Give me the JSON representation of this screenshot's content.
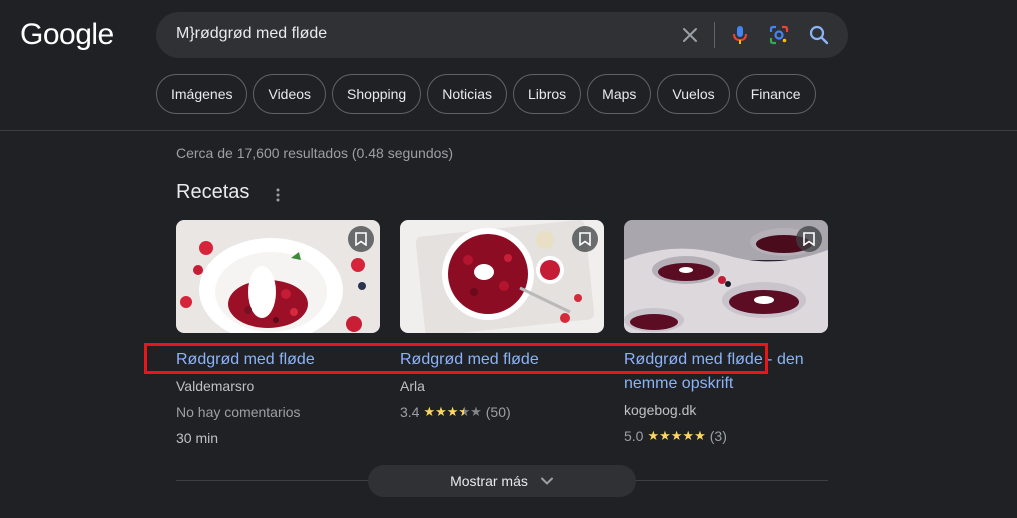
{
  "logo": "Google",
  "search": {
    "query": "M}rødgrød med fløde"
  },
  "chips": [
    "Imágenes",
    "Videos",
    "Shopping",
    "Noticias",
    "Libros",
    "Maps",
    "Vuelos",
    "Finance"
  ],
  "stats": "Cerca de 17,600 resultados (0.48 segundos)",
  "section": {
    "title": "Recetas"
  },
  "recipes": [
    {
      "title": "Rødgrød med fløde",
      "source": "Valdemarsro",
      "meta": "No hay comentarios",
      "time": "30 min"
    },
    {
      "title": "Rødgrød med fløde",
      "source": "Arla",
      "rating": "3.4",
      "reviews": "(50)"
    },
    {
      "title_main": "Rødgrød med fløde",
      "title_rest": " - den nemme opskrift",
      "source": "kogebog.dk",
      "rating": "5.0",
      "reviews": "(3)"
    }
  ],
  "show_more": "Mostrar más",
  "colors": {
    "background": "#202124",
    "link": "#8ab4f8",
    "highlight_box": "#e8151b",
    "star": "#fdd663"
  }
}
